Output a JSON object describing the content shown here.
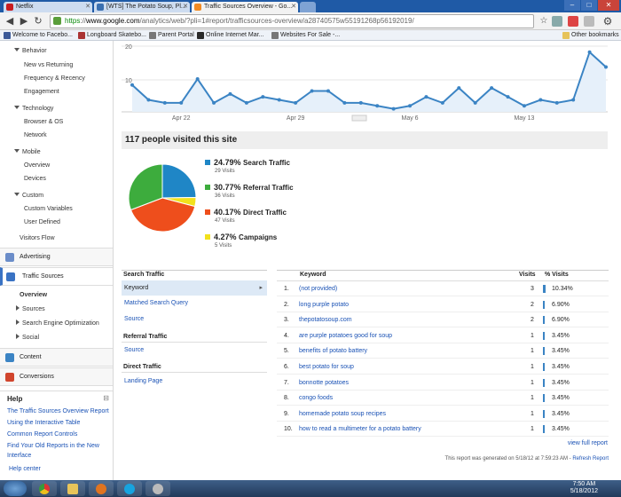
{
  "browser": {
    "tabs": [
      {
        "title": "Netflix",
        "color": "#c81c20"
      },
      {
        "title": "[WTS] The Potato Soup, Pl...",
        "color": "#3a6fb0"
      },
      {
        "title": "Traffic Sources Overview - Go...",
        "color": "#f08a24"
      }
    ],
    "url_https": "https",
    "url_sep": "://",
    "url_domain": "www.google.com",
    "url_rest": "/analytics/web/?pli=1#report/trafficsources-overview/a28740575w55191268p56192019/",
    "bookmarks": [
      {
        "label": "Welcome to Facebo...",
        "color": "#3b5998"
      },
      {
        "label": "Longboard Skatebo...",
        "color": "#a33"
      },
      {
        "label": "Parent Portal",
        "color": "#777"
      },
      {
        "label": "Online Internet Mar...",
        "color": "#2a2a2a"
      },
      {
        "label": "Websites For Sale -...",
        "color": "#777"
      }
    ],
    "other_bookmarks": "Other bookmarks"
  },
  "sidebar": {
    "behavior": "Behavior",
    "behavior_items": [
      "New vs Returning",
      "Frequency & Recency",
      "Engagement"
    ],
    "technology": "Technology",
    "technology_items": [
      "Browser & OS",
      "Network"
    ],
    "mobile": "Mobile",
    "mobile_items": [
      "Overview",
      "Devices"
    ],
    "custom": "Custom",
    "custom_items": [
      "Custom Variables",
      "User Defined"
    ],
    "visitors_flow": "Visitors Flow",
    "advertising": "Advertising",
    "traffic_sources": "Traffic Sources",
    "ts_overview": "Overview",
    "ts_items": [
      "Sources",
      "Search Engine Optimization",
      "Social"
    ],
    "content": "Content",
    "conversions": "Conversions",
    "help_title": "Help",
    "help_collapse": "⊟",
    "help_links": [
      "The Traffic Sources Overview Report",
      "Using the Interactive Table",
      "Common Report Controls",
      "Find Your Old Reports in the New Interface"
    ],
    "help_center": "Help center"
  },
  "chart_data": {
    "type": "line",
    "y_ticks": [
      "20",
      "10"
    ],
    "x_labels": [
      "Apr 22",
      "Apr 29",
      "May 6",
      "May 13"
    ],
    "ylim": [
      0,
      22
    ],
    "values": [
      9,
      4,
      3,
      3,
      11,
      3,
      6,
      3,
      5,
      4,
      3,
      7,
      7,
      3,
      3,
      2,
      1,
      2,
      5,
      3,
      8,
      3,
      8,
      5,
      2,
      4,
      3,
      4,
      20,
      15
    ],
    "color": "#3b84c4"
  },
  "visits_title": "117 people visited this site",
  "pie": {
    "segments": [
      {
        "pct": "24.79%",
        "label": "Search Traffic",
        "visits": "29 Visits",
        "value": 24.79,
        "color": "#1f86c6"
      },
      {
        "pct": "30.77%",
        "label": "Referral Traffic",
        "visits": "36 Visits",
        "value": 30.77,
        "color": "#3dac3d"
      },
      {
        "pct": "40.17%",
        "label": "Direct Traffic",
        "visits": "47 Visits",
        "value": 40.17,
        "color": "#ee4e1c"
      },
      {
        "pct": "4.27%",
        "label": "Campaigns",
        "visits": "5 Visits",
        "value": 4.27,
        "color": "#f2e11c"
      }
    ]
  },
  "left_table": {
    "search_traffic": "Search Traffic",
    "search_items": [
      "Keyword",
      "Matched Search Query",
      "Source"
    ],
    "referral_traffic": "Referral Traffic",
    "referral_items": [
      "Source"
    ],
    "direct_traffic": "Direct Traffic",
    "direct_items": [
      "Landing Page"
    ]
  },
  "table": {
    "headers": {
      "keyword": "Keyword",
      "visits": "Visits",
      "pct": "% Visits"
    },
    "rows": [
      {
        "n": "1.",
        "kw": "(not provided)",
        "v": "3",
        "p": "10.34%",
        "frac": 0.1034
      },
      {
        "n": "2.",
        "kw": "long purple potato",
        "v": "2",
        "p": "6.90%",
        "frac": 0.069
      },
      {
        "n": "3.",
        "kw": "thepotatosoup.com",
        "v": "2",
        "p": "6.90%",
        "frac": 0.069
      },
      {
        "n": "4.",
        "kw": "are purple potatoes good for soup",
        "v": "1",
        "p": "3.45%",
        "frac": 0.0345
      },
      {
        "n": "5.",
        "kw": "benefits of potato battery",
        "v": "1",
        "p": "3.45%",
        "frac": 0.0345
      },
      {
        "n": "6.",
        "kw": "best potato for soup",
        "v": "1",
        "p": "3.45%",
        "frac": 0.0345
      },
      {
        "n": "7.",
        "kw": "bonnotte potatoes",
        "v": "1",
        "p": "3.45%",
        "frac": 0.0345
      },
      {
        "n": "8.",
        "kw": "congo foods",
        "v": "1",
        "p": "3.45%",
        "frac": 0.0345
      },
      {
        "n": "9.",
        "kw": "homemade potato soup recipes",
        "v": "1",
        "p": "3.45%",
        "frac": 0.0345
      },
      {
        "n": "10.",
        "kw": "how to read a multimeter for a potato battery",
        "v": "1",
        "p": "3.45%",
        "frac": 0.0345
      }
    ],
    "view_full": "view full report"
  },
  "footer_note": "This report was generated on 5/18/12 at 7:59:23 AM - ",
  "refresh": "Refresh Report",
  "clock": {
    "time": "7:50 AM",
    "date": "5/18/2012"
  }
}
